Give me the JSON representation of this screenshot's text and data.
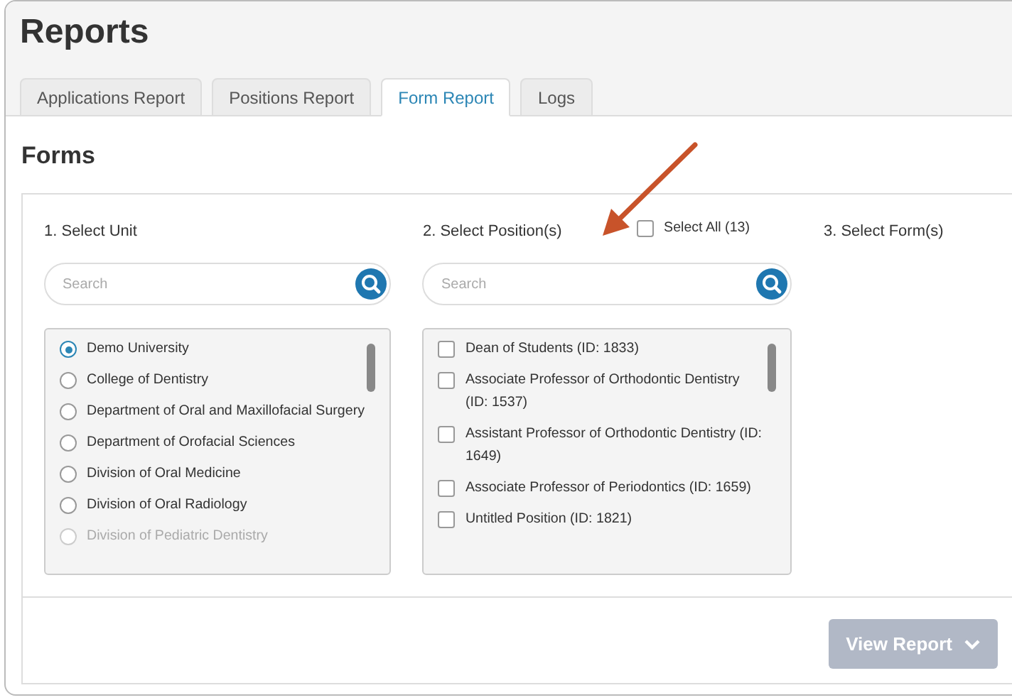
{
  "page_title": "Reports",
  "tabs": [
    {
      "label": "Applications Report",
      "selected": false
    },
    {
      "label": "Positions Report",
      "selected": false
    },
    {
      "label": "Form Report",
      "selected": true
    },
    {
      "label": "Logs",
      "selected": false
    }
  ],
  "section_title": "Forms",
  "unit_column": {
    "label": "1. Select Unit",
    "search": {
      "placeholder": "Search"
    },
    "items": [
      {
        "label": "Demo University",
        "selected": true,
        "faded": false
      },
      {
        "label": "College of Dentistry",
        "selected": false,
        "faded": false
      },
      {
        "label": "Department of Oral and Maxillofacial Surgery",
        "selected": false,
        "faded": false
      },
      {
        "label": "Department of Orofacial Sciences",
        "selected": false,
        "faded": false
      },
      {
        "label": "Division of Oral Medicine",
        "selected": false,
        "faded": false
      },
      {
        "label": "Division of Oral Radiology",
        "selected": false,
        "faded": false
      },
      {
        "label": "Division of Pediatric Dentistry",
        "selected": false,
        "faded": true
      }
    ]
  },
  "position_column": {
    "label": "2. Select Position(s)",
    "select_all": {
      "label": "Select All (13)",
      "checked": false
    },
    "search": {
      "placeholder": "Search"
    },
    "items": [
      {
        "label": "Dean of Students (ID: 1833)",
        "checked": false
      },
      {
        "label": "Associate Professor of Orthodontic Dentistry (ID: 1537)",
        "checked": false
      },
      {
        "label": "Assistant Professor of Orthodontic Dentistry (ID: 1649)",
        "checked": false
      },
      {
        "label": "Associate Professor of Periodontics (ID: 1659)",
        "checked": false
      },
      {
        "label": "Untitled Position (ID: 1821)",
        "checked": false
      }
    ]
  },
  "form_column": {
    "label": "3. Select Form(s)"
  },
  "view_button": {
    "label": "View Report",
    "disabled": true
  }
}
